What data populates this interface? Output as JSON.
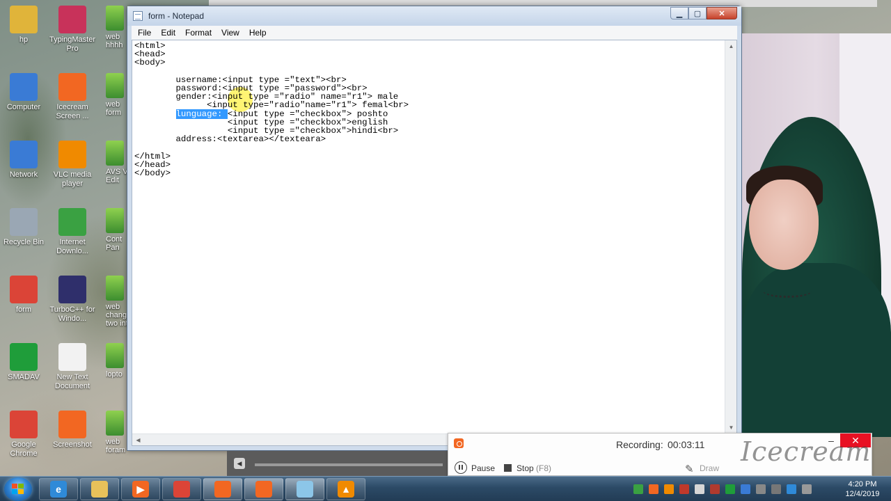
{
  "desktop_icons": [
    {
      "label": "hp",
      "name": "hp-icon",
      "color": "#e0b43a"
    },
    {
      "label": "TypingMaster Pro",
      "name": "typingmaster-icon",
      "color": "#c8325a"
    },
    {
      "label": "Computer",
      "name": "computer-icon",
      "color": "#3a7bd5"
    },
    {
      "label": "Icecream Screen ...",
      "name": "icecream-screen-icon",
      "color": "#f26722"
    },
    {
      "label": "Network",
      "name": "network-icon",
      "color": "#3a7bd5"
    },
    {
      "label": "VLC media player",
      "name": "vlc-icon",
      "color": "#f08a00"
    },
    {
      "label": "Recycle Bin",
      "name": "recycle-bin-icon",
      "color": "#9aa7b4"
    },
    {
      "label": "Internet Downlo...",
      "name": "internet-download-manager-icon",
      "color": "#3aa142"
    },
    {
      "label": "form",
      "name": "chrome-form-icon",
      "color": "#db4437"
    },
    {
      "label": "TurboC++ for Windo...",
      "name": "turbocpp-icon",
      "color": "#2f2f6b"
    },
    {
      "label": "SMADAV",
      "name": "smadav-icon",
      "color": "#1f9d3a"
    },
    {
      "label": "New Text Document",
      "name": "text-document-icon",
      "color": "#f2f2f2"
    },
    {
      "label": "Google Chrome",
      "name": "google-chrome-icon",
      "color": "#db4437"
    },
    {
      "label": "Screenshot",
      "name": "screenshot-icon",
      "color": "#f26722"
    }
  ],
  "partial_icons": [
    {
      "label": "web\nhhhh",
      "name": "web-partial-icon-1"
    },
    {
      "label": "web\nform",
      "name": "web-partial-icon-2"
    },
    {
      "label": "AVS Vi\nEdit",
      "name": "avs-video-editor-partial-icon"
    },
    {
      "label": "Cont\nPan",
      "name": "control-panel-partial-icon"
    },
    {
      "label": "web\nchang\ntwo int",
      "name": "web-partial-icon-3"
    },
    {
      "label": "lopto",
      "name": "laptop-partial-icon"
    },
    {
      "label": "web\nforam",
      "name": "web-partial-icon-4"
    }
  ],
  "notepad": {
    "title": "form - Notepad",
    "menu": [
      "File",
      "Edit",
      "Format",
      "View",
      "Help"
    ],
    "lines_before": "<html>\n<head>\n<body>\n\n        username:<input type =\"text\"><br>\n        password:<input type =\"password\"><br>\n        gender:<input type =\"radio\" name=\"r1\"> male\n              <input type=\"radio\"name=\"r1\"> femal<br>\n        ",
    "selected_text": "lunguage: ",
    "lines_after": "<input type =\"checkbox\"> poshto\n                  <input type =\"checkbox\">english\n                  <input type =\"checkbox\">hindi<br>\n        address:<textarea></texteara>\n\n</html>\n</head>\n</body>"
  },
  "recorder": {
    "status_label": "Recording:",
    "time": "00:03:11",
    "pause_label": "Pause",
    "stop_label": "Stop",
    "stop_shortcut": "(F8)",
    "draw_label": "Draw",
    "watermark": "Icecream",
    "close_symbol": "✕",
    "minimize_symbol": "–",
    "accent": "#f26722"
  },
  "taskbar": {
    "items": [
      {
        "name": "internet-explorer-icon",
        "color": "#2f8ad8",
        "glyph": "e"
      },
      {
        "name": "file-explorer-icon",
        "color": "#e8c15a",
        "glyph": ""
      },
      {
        "name": "media-player-icon",
        "color": "#f26722",
        "glyph": "▶"
      },
      {
        "name": "chrome-taskbar-icon",
        "color": "#db4437",
        "glyph": ""
      },
      {
        "name": "icecream-recorder-taskbar-icon",
        "color": "#f26722",
        "glyph": ""
      },
      {
        "name": "screenshot-taskbar-icon",
        "color": "#f26722",
        "glyph": ""
      },
      {
        "name": "notepad-taskbar-icon",
        "color": "#8cc6e8",
        "glyph": ""
      },
      {
        "name": "vlc-taskbar-icon",
        "color": "#f08a00",
        "glyph": "▲"
      }
    ],
    "time": "4:20 PM",
    "date": "12/4/2019"
  }
}
